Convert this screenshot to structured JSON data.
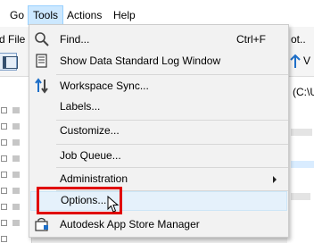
{
  "menubar": {
    "items": [
      {
        "label": "Go"
      },
      {
        "label": "Tools"
      },
      {
        "label": "Actions"
      },
      {
        "label": "Help"
      }
    ]
  },
  "background": {
    "left_toolbar_text": "d File",
    "right_toolbar_text": "ot..",
    "right_path_text": "(C:\\U",
    "right_toolbar_letter": "V"
  },
  "tools_menu": {
    "items": [
      {
        "label": "Find...",
        "shortcut": "Ctrl+F",
        "icon": "search-icon"
      },
      {
        "label": "Show Data Standard Log Window",
        "icon": "log-window-icon"
      },
      {
        "label": "Workspace Sync...",
        "icon": "sync-arrows-icon"
      },
      {
        "label": "Labels..."
      },
      {
        "label": "Customize..."
      },
      {
        "label": "Job Queue..."
      },
      {
        "label": "Administration",
        "has_submenu": true
      },
      {
        "label": "Options...",
        "hovered": true
      },
      {
        "label": "Autodesk App Store Manager",
        "icon": "app-store-icon"
      }
    ]
  },
  "colors": {
    "highlight_outline": "#e00000",
    "hover_background": "#e5f1fb",
    "active_menu_background": "#cce8ff"
  }
}
